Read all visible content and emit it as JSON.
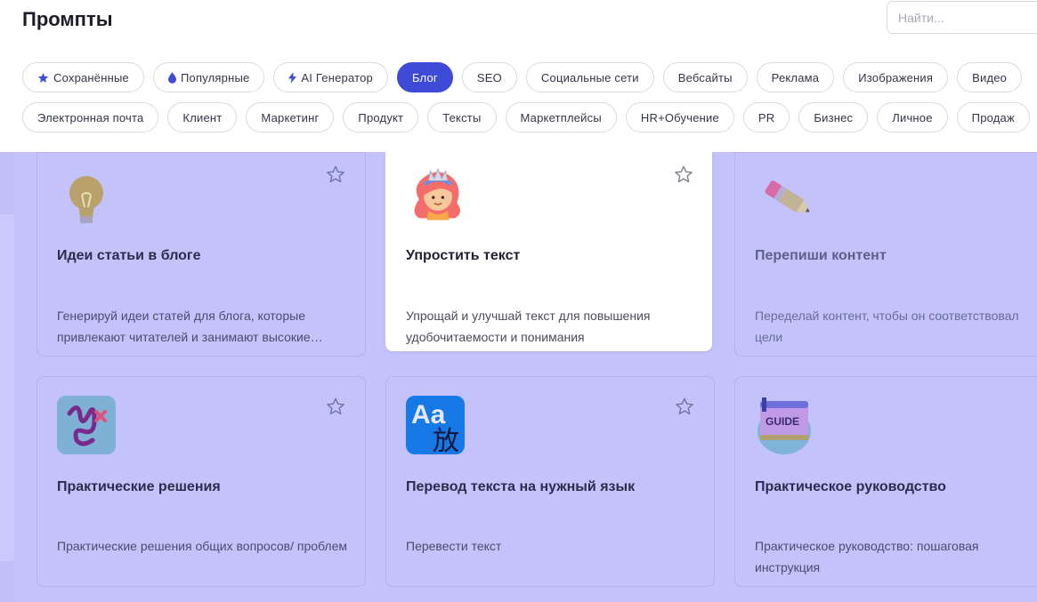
{
  "header": {
    "title": "Промпты",
    "search_placeholder": "Найти..."
  },
  "categories_row1": [
    {
      "label": "Сохранённые",
      "icon": "star-icon"
    },
    {
      "label": "Популярные",
      "icon": "drop-icon"
    },
    {
      "label": "AI Генератор",
      "icon": "bolt-icon"
    },
    {
      "label": "Блог",
      "active": true
    },
    {
      "label": "SEO"
    },
    {
      "label": "Социальные сети"
    },
    {
      "label": "Вебсайты"
    },
    {
      "label": "Реклама"
    },
    {
      "label": "Изображения"
    },
    {
      "label": "Видео"
    }
  ],
  "categories_row2": [
    {
      "label": "Электронная почта"
    },
    {
      "label": "Клиент"
    },
    {
      "label": "Маркетинг"
    },
    {
      "label": "Продукт"
    },
    {
      "label": "Тексты"
    },
    {
      "label": "Маркетплейсы"
    },
    {
      "label": "HR+Обучение"
    },
    {
      "label": "PR"
    },
    {
      "label": "Бизнес"
    },
    {
      "label": "Личное"
    },
    {
      "label": "Продаж"
    }
  ],
  "cards": [
    {
      "title": "Идеи статьи в блоге",
      "description": "Генерируй идеи статей для блога, которые привлекают читателей и занимают высокие…",
      "icon": "lightbulb-icon"
    },
    {
      "title": "Упростить текст",
      "description": "Упрощай и улучшай текст для повышения удобочитаемости и понимания",
      "icon": "girl-avatar-icon",
      "highlighted": true
    },
    {
      "title": "Перепиши контент",
      "description": "Переделай контент, чтобы он соответствовал цели",
      "icon": "pencil-icon"
    },
    {
      "title": "Практические решения",
      "description": "Практические решения общих вопросов/ проблем",
      "icon": "squiggle-icon"
    },
    {
      "title": "Перевод текста на нужный язык",
      "description": "Перевести текст",
      "icon": "translate-icon",
      "icon_text": "Aa",
      "icon_char": "放"
    },
    {
      "title": "Практическое руководство",
      "description": "Практическое руководство: пошаговая инструкция",
      "icon": "guide-book-icon",
      "icon_text": "GUIDE"
    }
  ],
  "colors": {
    "accent": "#3f4bd6",
    "overlay": "#c3c2fb",
    "card_border": "#b3b1f2"
  }
}
